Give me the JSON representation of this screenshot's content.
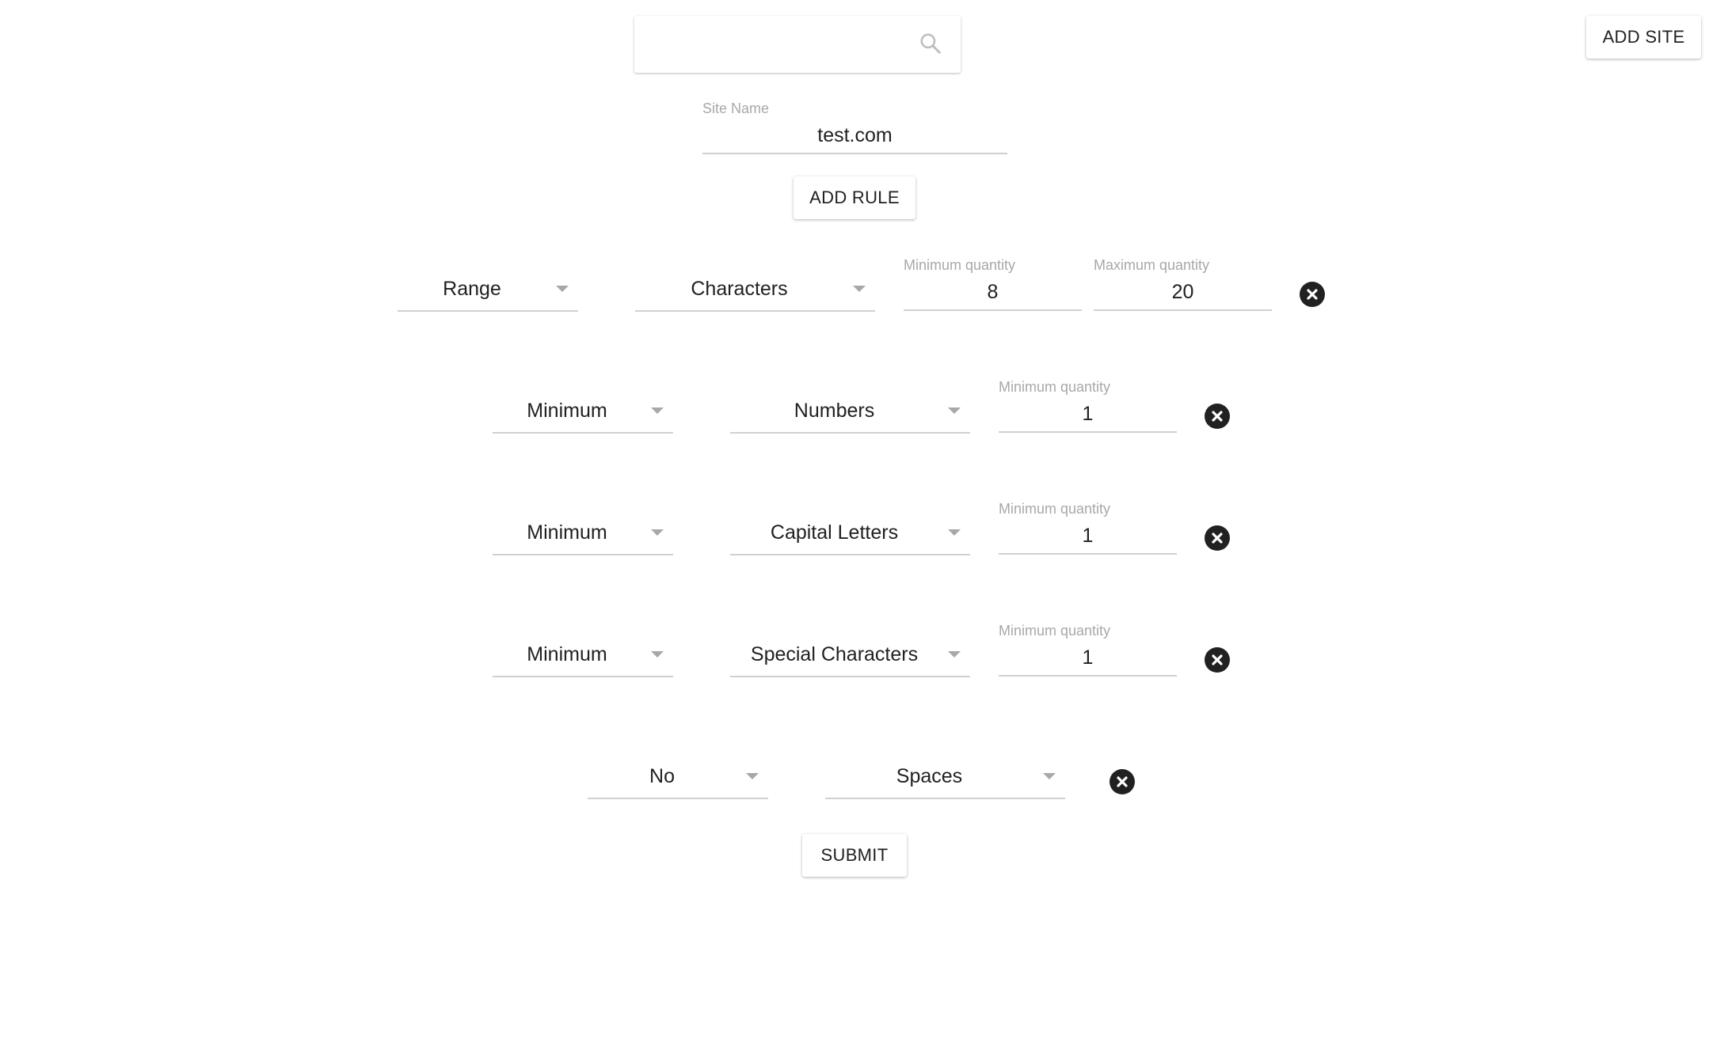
{
  "header": {
    "search": {
      "value": "",
      "placeholder": ""
    },
    "add_site_label": "ADD SITE"
  },
  "site": {
    "name_label": "Site Name",
    "name_value": "test.com"
  },
  "add_rule_label": "ADD RULE",
  "rules": [
    {
      "mode": "Range",
      "type": "Characters",
      "min_label": "Minimum quantity",
      "min_value": "8",
      "max_label": "Maximum quantity",
      "max_value": "20"
    },
    {
      "mode": "Minimum",
      "type": "Numbers",
      "min_label": "Minimum quantity",
      "min_value": "1"
    },
    {
      "mode": "Minimum",
      "type": "Capital Letters",
      "min_label": "Minimum quantity",
      "min_value": "1"
    },
    {
      "mode": "Minimum",
      "type": "Special Characters",
      "min_label": "Minimum quantity",
      "min_value": "1"
    },
    {
      "mode": "No",
      "type": "Spaces"
    }
  ],
  "submit_label": "SUBMIT",
  "icons": {
    "search": "search-icon",
    "remove": "close-circle-icon",
    "dropdown": "caret-down-icon"
  },
  "colors": {
    "text": "#212121",
    "label": "#a8a8a8",
    "underline": "#d0d0d0",
    "remove_icon": "#212121"
  }
}
